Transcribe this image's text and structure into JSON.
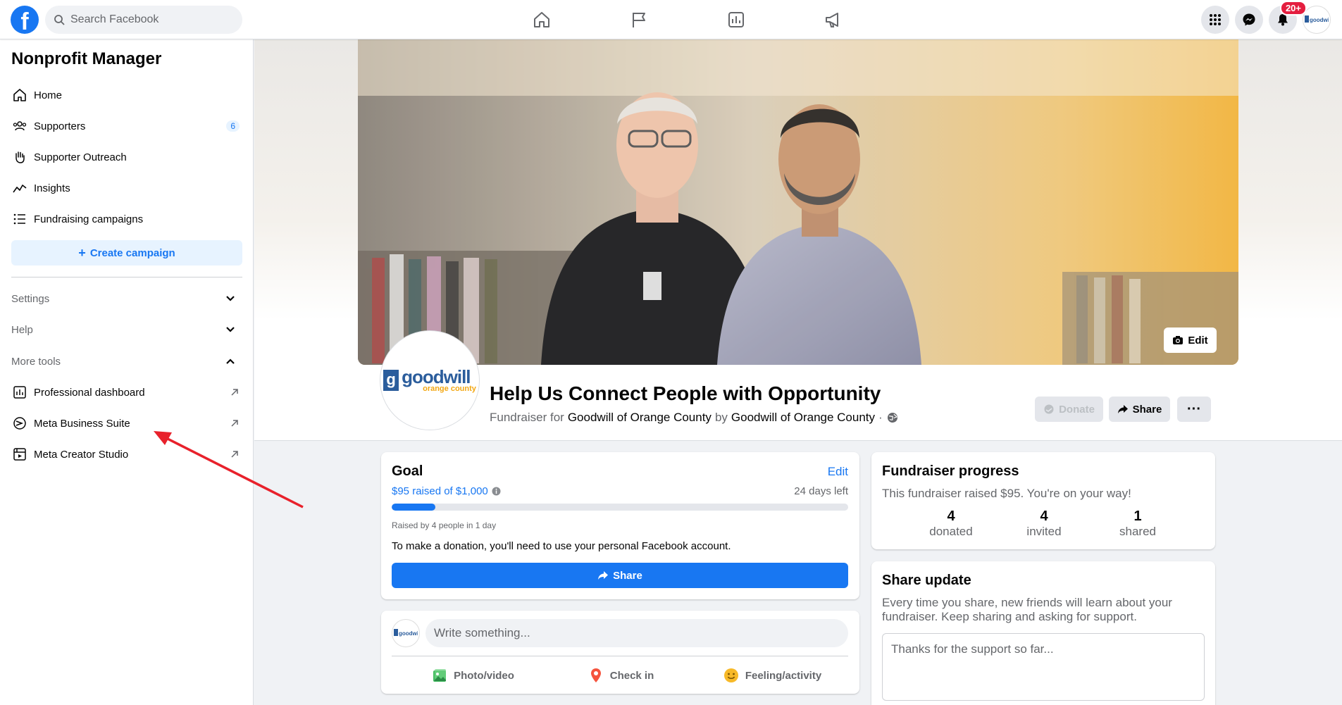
{
  "topbar": {
    "logo": "f",
    "search_placeholder": "Search Facebook",
    "nav_icons": [
      "home-icon",
      "flag-icon",
      "chart-icon",
      "megaphone-icon"
    ],
    "notifications_badge": "20+"
  },
  "sidebar": {
    "title": "Nonprofit Manager",
    "items": [
      {
        "label": "Home",
        "icon": "home-icon"
      },
      {
        "label": "Supporters",
        "icon": "people-icon",
        "count": "6"
      },
      {
        "label": "Supporter Outreach",
        "icon": "hand-icon"
      },
      {
        "label": "Insights",
        "icon": "trend-icon"
      },
      {
        "label": "Fundraising campaigns",
        "icon": "list-icon"
      }
    ],
    "create_button": "Create campaign",
    "sections": [
      {
        "label": "Settings",
        "state": "collapsed"
      },
      {
        "label": "Help",
        "state": "collapsed"
      },
      {
        "label": "More tools",
        "state": "expanded"
      }
    ],
    "tools": [
      {
        "label": "Professional dashboard",
        "icon": "dashboard-icon"
      },
      {
        "label": "Meta Business Suite",
        "icon": "meta-business-icon"
      },
      {
        "label": "Meta Creator Studio",
        "icon": "film-icon"
      }
    ]
  },
  "fundraiser": {
    "cover_edit": "Edit",
    "org_logo_word": "goodwill",
    "org_logo_sub": "orange county",
    "title": "Help Us Connect People with Opportunity",
    "prefix": "Fundraiser for",
    "org": "Goodwill of Orange County",
    "by": "by",
    "organizer": "Goodwill of Orange County",
    "separator": "·",
    "buttons": {
      "donate": "Donate",
      "share": "Share",
      "more": "···"
    }
  },
  "goal": {
    "heading": "Goal",
    "edit": "Edit",
    "raised": "$95 raised of $1,000",
    "days_left": "24 days left",
    "progress_fraction": 0.095,
    "raised_by": "Raised by 4 people in 1 day",
    "note": "To make a donation, you'll need to use your personal Facebook account.",
    "share": "Share"
  },
  "composer": {
    "placeholder": "Write something...",
    "actions": [
      "Photo/video",
      "Check in",
      "Feeling/activity"
    ]
  },
  "progress": {
    "heading": "Fundraiser progress",
    "summary": "This fundraiser raised $95. You're on your way!",
    "stats": [
      {
        "num": "4",
        "label": "donated"
      },
      {
        "num": "4",
        "label": "invited"
      },
      {
        "num": "1",
        "label": "shared"
      }
    ]
  },
  "share_update": {
    "heading": "Share update",
    "description": "Every time you share, new friends will learn about your fundraiser. Keep sharing and asking for support.",
    "placeholder": "Thanks for the support so far..."
  },
  "colors": {
    "brand": "#1877f2",
    "annotation_arrow": "#e8212b",
    "goodwill_blue": "#2b5d9c",
    "goodwill_orange": "#f3a712"
  }
}
